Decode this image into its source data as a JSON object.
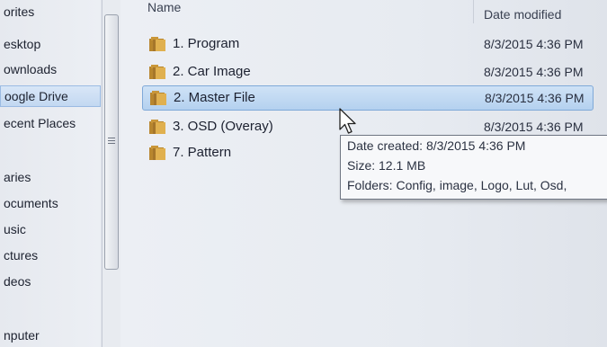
{
  "nav": {
    "items": [
      {
        "label": "orites"
      },
      {
        "label": "esktop"
      },
      {
        "label": "ownloads"
      },
      {
        "label": "oogle Drive"
      },
      {
        "label": "ecent Places"
      },
      {
        "label": "aries"
      },
      {
        "label": "ocuments"
      },
      {
        "label": "usic"
      },
      {
        "label": "ctures"
      },
      {
        "label": "deos"
      },
      {
        "label": "nputer"
      }
    ],
    "selected_index": 3
  },
  "columns": {
    "name": "Name",
    "date_modified": "Date modified"
  },
  "rows": [
    {
      "name": "1. Program",
      "date": "8/3/2015 4:36 PM",
      "icon": "folder-icon"
    },
    {
      "name": "2. Car Image",
      "date": "8/3/2015 4:36 PM",
      "icon": "folder-icon"
    },
    {
      "name": "2. Master File",
      "date": "8/3/2015 4:36 PM",
      "icon": "folder-icon"
    },
    {
      "name": "3. OSD (Overay)",
      "date": "8/3/2015 4:36 PM",
      "icon": "folder-icon"
    },
    {
      "name": "7. Pattern",
      "date": "",
      "icon": "folder-icon"
    }
  ],
  "selected_row": 2,
  "tooltip": {
    "date_created": "Date created: 8/3/2015 4:36 PM",
    "size": "Size: 12.1 MB",
    "folders": "Folders: Config, image, Logo, Lut, Osd,"
  },
  "colors": {
    "selection": "#b4d1ef",
    "folder": "#d9a441"
  }
}
